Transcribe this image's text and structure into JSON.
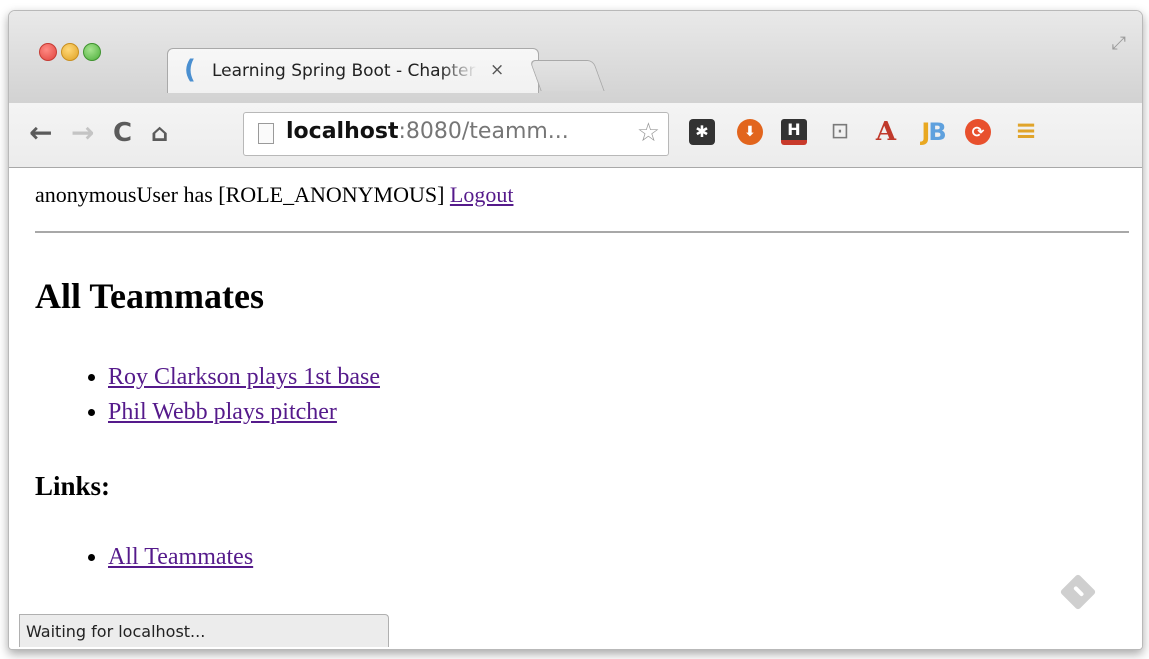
{
  "browser": {
    "tab": {
      "title": "Learning Spring Boot - Chapter",
      "close_glyph": "×",
      "favicon": "spring-leaf-icon"
    },
    "toolbar": {
      "back_icon": "←",
      "forward_icon": "→",
      "reload_icon": "C",
      "home_icon": "⌂",
      "url_host": "localhost",
      "url_rest": ":8080/teamm...",
      "star_icon": "☆"
    },
    "extensions": [
      {
        "name": "puzzle-extension-icon",
        "glyph": "✱"
      },
      {
        "name": "download-extension-icon",
        "glyph": "⬇"
      },
      {
        "name": "h-extension-icon",
        "glyph": "H"
      },
      {
        "name": "cast-icon",
        "glyph": "⊡"
      },
      {
        "name": "acrobat-extension-icon",
        "glyph": "A"
      },
      {
        "name": "jb-extension-icon",
        "glyph_a": "J",
        "glyph_b": "B"
      },
      {
        "name": "sync-extension-icon",
        "glyph": "⟳"
      },
      {
        "name": "menu-icon",
        "glyph": "≡"
      }
    ],
    "status": "Waiting for localhost..."
  },
  "page": {
    "user_text": "anonymousUser has [ROLE_ANONYMOUS]",
    "logout_label": "Logout",
    "heading": "All Teammates",
    "teammates": [
      "Roy Clarkson plays 1st base",
      "Phil Webb plays pitcher"
    ],
    "links_heading": "Links:",
    "links": [
      "All Teammates"
    ]
  },
  "colors": {
    "link": "#551a8b",
    "traffic_red": "#e0443e",
    "traffic_yellow": "#dfa123",
    "traffic_green": "#4caf3a"
  }
}
